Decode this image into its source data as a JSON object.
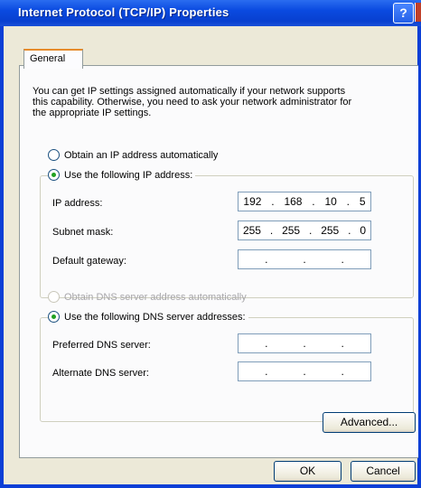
{
  "window": {
    "title": "Internet Protocol (TCP/IP) Properties",
    "help_label": "?"
  },
  "tabs": [
    {
      "label": "General"
    }
  ],
  "intro_text": "You can get IP settings assigned automatically if your network supports\nthis capability. Otherwise, you need to ask your network administrator for\nthe appropriate IP settings.",
  "ip_options": {
    "auto_label": "Obtain an IP address automatically",
    "manual_label": "Use the following IP address:",
    "selected": "manual"
  },
  "ip_fields": [
    {
      "label": "IP address:",
      "octets": [
        "192",
        "168",
        "10",
        "5"
      ]
    },
    {
      "label": "Subnet mask:",
      "octets": [
        "255",
        "255",
        "255",
        "0"
      ]
    },
    {
      "label": "Default gateway:",
      "octets": [
        "",
        "",
        "",
        ""
      ]
    }
  ],
  "dns_options": {
    "auto_label": "Obtain DNS server address automatically",
    "manual_label": "Use the following DNS server addresses:",
    "selected": "manual",
    "auto_disabled": true
  },
  "dns_fields": [
    {
      "label": "Preferred DNS server:",
      "octets": [
        "",
        "",
        "",
        ""
      ]
    },
    {
      "label": "Alternate DNS server:",
      "octets": [
        "",
        "",
        "",
        ""
      ]
    }
  ],
  "buttons": {
    "advanced": "Advanced...",
    "ok": "OK",
    "cancel": "Cancel"
  },
  "separator": "."
}
